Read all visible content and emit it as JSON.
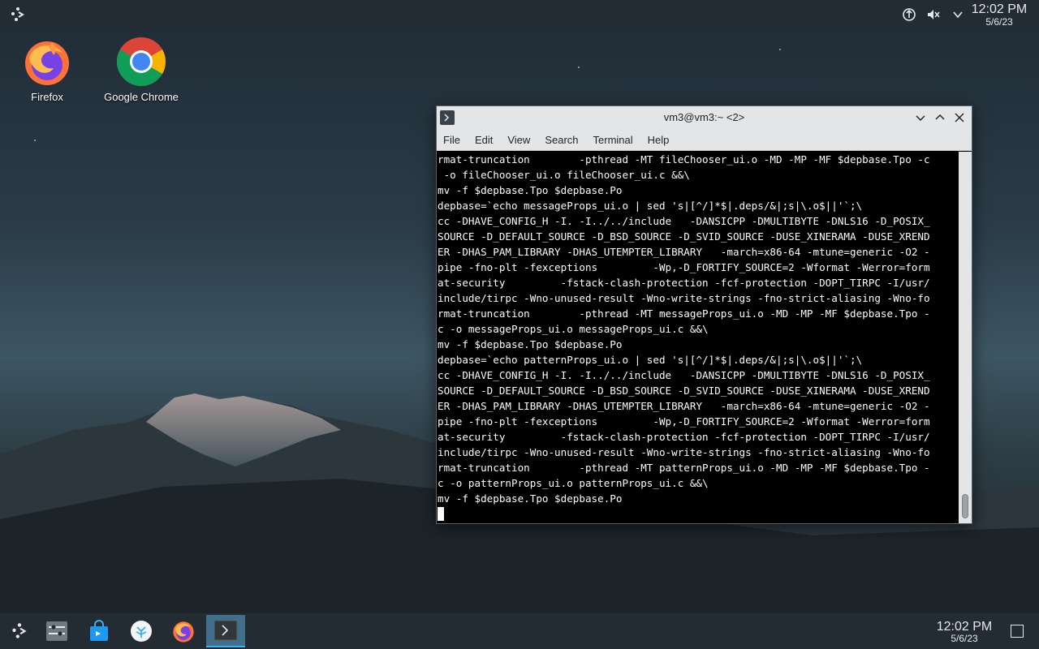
{
  "top_panel": {
    "clock_time": "12:02 PM",
    "clock_date": "5/6/23",
    "tray_icons": [
      "network-icon",
      "volume-muted-icon",
      "chevron-down-icon"
    ]
  },
  "desktop": {
    "icons": [
      {
        "label": "Firefox",
        "icon": "firefox-icon"
      },
      {
        "label": "Google Chrome",
        "icon": "chrome-icon"
      }
    ]
  },
  "terminal": {
    "title": "vm3@vm3:~ <2>",
    "menu": [
      "File",
      "Edit",
      "View",
      "Search",
      "Terminal",
      "Help"
    ],
    "lines": [
      "rmat-truncation        -pthread -MT fileChooser_ui.o -MD -MP -MF $depbase.Tpo -c",
      " -o fileChooser_ui.o fileChooser_ui.c &&\\",
      "mv -f $depbase.Tpo $depbase.Po",
      "depbase=`echo messageProps_ui.o | sed 's|[^/]*$|.deps/&|;s|\\.o$||'`;\\",
      "cc -DHAVE_CONFIG_H -I. -I../../include   -DANSICPP -DMULTIBYTE -DNLS16 -D_POSIX_",
      "SOURCE -D_DEFAULT_SOURCE -D_BSD_SOURCE -D_SVID_SOURCE -DUSE_XINERAMA -DUSE_XREND",
      "ER -DHAS_PAM_LIBRARY -DHAS_UTEMPTER_LIBRARY   -march=x86-64 -mtune=generic -O2 -",
      "pipe -fno-plt -fexceptions         -Wp,-D_FORTIFY_SOURCE=2 -Wformat -Werror=form",
      "at-security         -fstack-clash-protection -fcf-protection -DOPT_TIRPC -I/usr/",
      "include/tirpc -Wno-unused-result -Wno-write-strings -fno-strict-aliasing -Wno-fo",
      "rmat-truncation        -pthread -MT messageProps_ui.o -MD -MP -MF $depbase.Tpo -",
      "c -o messageProps_ui.o messageProps_ui.c &&\\",
      "mv -f $depbase.Tpo $depbase.Po",
      "depbase=`echo patternProps_ui.o | sed 's|[^/]*$|.deps/&|;s|\\.o$||'`;\\",
      "cc -DHAVE_CONFIG_H -I. -I../../include   -DANSICPP -DMULTIBYTE -DNLS16 -D_POSIX_",
      "SOURCE -D_DEFAULT_SOURCE -D_BSD_SOURCE -D_SVID_SOURCE -DUSE_XINERAMA -DUSE_XREND",
      "ER -DHAS_PAM_LIBRARY -DHAS_UTEMPTER_LIBRARY   -march=x86-64 -mtune=generic -O2 -",
      "pipe -fno-plt -fexceptions         -Wp,-D_FORTIFY_SOURCE=2 -Wformat -Werror=form",
      "at-security         -fstack-clash-protection -fcf-protection -DOPT_TIRPC -I/usr/",
      "include/tirpc -Wno-unused-result -Wno-write-strings -fno-strict-aliasing -Wno-fo",
      "rmat-truncation        -pthread -MT patternProps_ui.o -MD -MP -MF $depbase.Tpo -",
      "c -o patternProps_ui.o patternProps_ui.c &&\\",
      "mv -f $depbase.Tpo $depbase.Po",
      ""
    ]
  },
  "taskbar": {
    "items": [
      "application-launcher-icon",
      "system-settings-icon",
      "discover-store-icon",
      "welcome-center-icon",
      "firefox-icon",
      "konsole-icon"
    ],
    "active_item": "konsole-icon",
    "clock_time": "12:02 PM",
    "clock_date": "5/6/23"
  },
  "colors": {
    "accent": "#3daee9",
    "terminal_bg": "#000000",
    "terminal_fg": "#fcfcfc"
  }
}
